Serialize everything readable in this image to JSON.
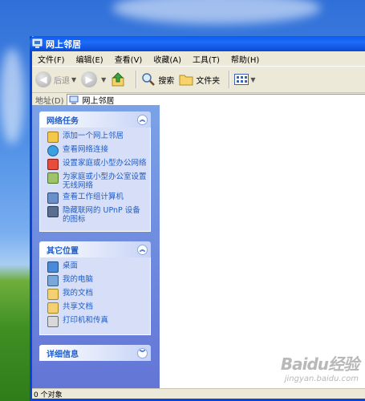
{
  "window": {
    "title": "网上邻居"
  },
  "menubar": [
    {
      "label": "文件(F)"
    },
    {
      "label": "编辑(E)"
    },
    {
      "label": "查看(V)"
    },
    {
      "label": "收藏(A)"
    },
    {
      "label": "工具(T)"
    },
    {
      "label": "帮助(H)"
    }
  ],
  "toolbar": {
    "back_label": "后退",
    "search_label": "搜索",
    "folders_label": "文件夹"
  },
  "address": {
    "label": "地址(D)",
    "value": "网上邻居"
  },
  "panels": {
    "network_tasks": {
      "title": "网络任务",
      "items": [
        {
          "label": "添加一个网上邻居",
          "icon": "add-network-place-icon"
        },
        {
          "label": "查看网络连接",
          "icon": "network-connections-icon"
        },
        {
          "label": "设置家庭或小型办公网络",
          "icon": "home-network-setup-icon"
        },
        {
          "label": "为家庭或小型办公室设置无线网络",
          "icon": "wireless-network-icon"
        },
        {
          "label": "查看工作组计算机",
          "icon": "workgroup-computers-icon"
        },
        {
          "label": "隐藏联网的 UPnP 设备的图标",
          "icon": "upnp-device-icon"
        }
      ]
    },
    "other_places": {
      "title": "其它位置",
      "items": [
        {
          "label": "桌面",
          "icon": "desktop-icon"
        },
        {
          "label": "我的电脑",
          "icon": "my-computer-icon"
        },
        {
          "label": "我的文档",
          "icon": "my-documents-icon"
        },
        {
          "label": "共享文档",
          "icon": "shared-documents-icon"
        },
        {
          "label": "打印机和传真",
          "icon": "printers-faxes-icon"
        }
      ]
    },
    "details": {
      "title": "详细信息"
    }
  },
  "status": {
    "text": "0 个对象"
  },
  "watermark": {
    "logo": "Baidu经验",
    "url": "jingyan.baidu.com"
  }
}
